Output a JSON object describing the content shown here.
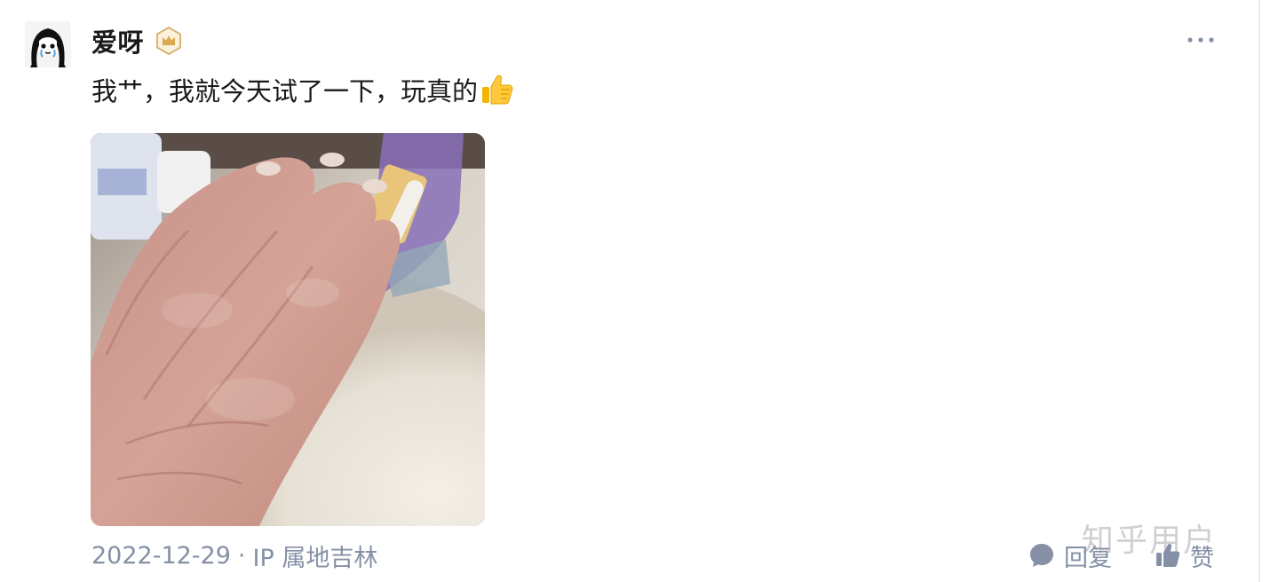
{
  "author": {
    "name": "爱呀",
    "avatar_icon": "cartoon-girl-avatar",
    "badge_icon": "crown-badge-icon",
    "badge_color": "#d9b476"
  },
  "content": {
    "text": "我艹，我就今天试了一下，玩真的",
    "emoji_icon": "thumbs-up-icon"
  },
  "photo": {
    "description_icon": "hand-photo"
  },
  "meta": {
    "date": "2022-12-29",
    "separator": "·",
    "location": "IP 属地吉林"
  },
  "actions": {
    "reply_label": "回复",
    "like_label": "赞",
    "more_icon": "more-dots-icon"
  },
  "watermark": "知乎用户",
  "colors": {
    "text_primary": "#1a1a1a",
    "text_secondary": "#8590a6",
    "icon_gray": "#8590a6"
  }
}
